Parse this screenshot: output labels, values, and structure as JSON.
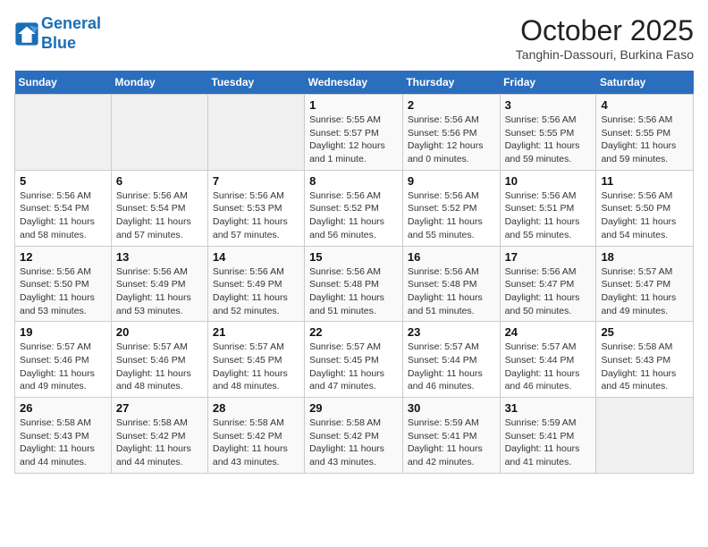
{
  "header": {
    "logo_line1": "General",
    "logo_line2": "Blue",
    "month": "October 2025",
    "location": "Tanghin-Dassouri, Burkina Faso"
  },
  "weekdays": [
    "Sunday",
    "Monday",
    "Tuesday",
    "Wednesday",
    "Thursday",
    "Friday",
    "Saturday"
  ],
  "weeks": [
    [
      {
        "day": "",
        "info": ""
      },
      {
        "day": "",
        "info": ""
      },
      {
        "day": "",
        "info": ""
      },
      {
        "day": "1",
        "info": "Sunrise: 5:55 AM\nSunset: 5:57 PM\nDaylight: 12 hours and 1 minute."
      },
      {
        "day": "2",
        "info": "Sunrise: 5:56 AM\nSunset: 5:56 PM\nDaylight: 12 hours and 0 minutes."
      },
      {
        "day": "3",
        "info": "Sunrise: 5:56 AM\nSunset: 5:55 PM\nDaylight: 11 hours and 59 minutes."
      },
      {
        "day": "4",
        "info": "Sunrise: 5:56 AM\nSunset: 5:55 PM\nDaylight: 11 hours and 59 minutes."
      }
    ],
    [
      {
        "day": "5",
        "info": "Sunrise: 5:56 AM\nSunset: 5:54 PM\nDaylight: 11 hours and 58 minutes."
      },
      {
        "day": "6",
        "info": "Sunrise: 5:56 AM\nSunset: 5:54 PM\nDaylight: 11 hours and 57 minutes."
      },
      {
        "day": "7",
        "info": "Sunrise: 5:56 AM\nSunset: 5:53 PM\nDaylight: 11 hours and 57 minutes."
      },
      {
        "day": "8",
        "info": "Sunrise: 5:56 AM\nSunset: 5:52 PM\nDaylight: 11 hours and 56 minutes."
      },
      {
        "day": "9",
        "info": "Sunrise: 5:56 AM\nSunset: 5:52 PM\nDaylight: 11 hours and 55 minutes."
      },
      {
        "day": "10",
        "info": "Sunrise: 5:56 AM\nSunset: 5:51 PM\nDaylight: 11 hours and 55 minutes."
      },
      {
        "day": "11",
        "info": "Sunrise: 5:56 AM\nSunset: 5:50 PM\nDaylight: 11 hours and 54 minutes."
      }
    ],
    [
      {
        "day": "12",
        "info": "Sunrise: 5:56 AM\nSunset: 5:50 PM\nDaylight: 11 hours and 53 minutes."
      },
      {
        "day": "13",
        "info": "Sunrise: 5:56 AM\nSunset: 5:49 PM\nDaylight: 11 hours and 53 minutes."
      },
      {
        "day": "14",
        "info": "Sunrise: 5:56 AM\nSunset: 5:49 PM\nDaylight: 11 hours and 52 minutes."
      },
      {
        "day": "15",
        "info": "Sunrise: 5:56 AM\nSunset: 5:48 PM\nDaylight: 11 hours and 51 minutes."
      },
      {
        "day": "16",
        "info": "Sunrise: 5:56 AM\nSunset: 5:48 PM\nDaylight: 11 hours and 51 minutes."
      },
      {
        "day": "17",
        "info": "Sunrise: 5:56 AM\nSunset: 5:47 PM\nDaylight: 11 hours and 50 minutes."
      },
      {
        "day": "18",
        "info": "Sunrise: 5:57 AM\nSunset: 5:47 PM\nDaylight: 11 hours and 49 minutes."
      }
    ],
    [
      {
        "day": "19",
        "info": "Sunrise: 5:57 AM\nSunset: 5:46 PM\nDaylight: 11 hours and 49 minutes."
      },
      {
        "day": "20",
        "info": "Sunrise: 5:57 AM\nSunset: 5:46 PM\nDaylight: 11 hours and 48 minutes."
      },
      {
        "day": "21",
        "info": "Sunrise: 5:57 AM\nSunset: 5:45 PM\nDaylight: 11 hours and 48 minutes."
      },
      {
        "day": "22",
        "info": "Sunrise: 5:57 AM\nSunset: 5:45 PM\nDaylight: 11 hours and 47 minutes."
      },
      {
        "day": "23",
        "info": "Sunrise: 5:57 AM\nSunset: 5:44 PM\nDaylight: 11 hours and 46 minutes."
      },
      {
        "day": "24",
        "info": "Sunrise: 5:57 AM\nSunset: 5:44 PM\nDaylight: 11 hours and 46 minutes."
      },
      {
        "day": "25",
        "info": "Sunrise: 5:58 AM\nSunset: 5:43 PM\nDaylight: 11 hours and 45 minutes."
      }
    ],
    [
      {
        "day": "26",
        "info": "Sunrise: 5:58 AM\nSunset: 5:43 PM\nDaylight: 11 hours and 44 minutes."
      },
      {
        "day": "27",
        "info": "Sunrise: 5:58 AM\nSunset: 5:42 PM\nDaylight: 11 hours and 44 minutes."
      },
      {
        "day": "28",
        "info": "Sunrise: 5:58 AM\nSunset: 5:42 PM\nDaylight: 11 hours and 43 minutes."
      },
      {
        "day": "29",
        "info": "Sunrise: 5:58 AM\nSunset: 5:42 PM\nDaylight: 11 hours and 43 minutes."
      },
      {
        "day": "30",
        "info": "Sunrise: 5:59 AM\nSunset: 5:41 PM\nDaylight: 11 hours and 42 minutes."
      },
      {
        "day": "31",
        "info": "Sunrise: 5:59 AM\nSunset: 5:41 PM\nDaylight: 11 hours and 41 minutes."
      },
      {
        "day": "",
        "info": ""
      }
    ]
  ]
}
